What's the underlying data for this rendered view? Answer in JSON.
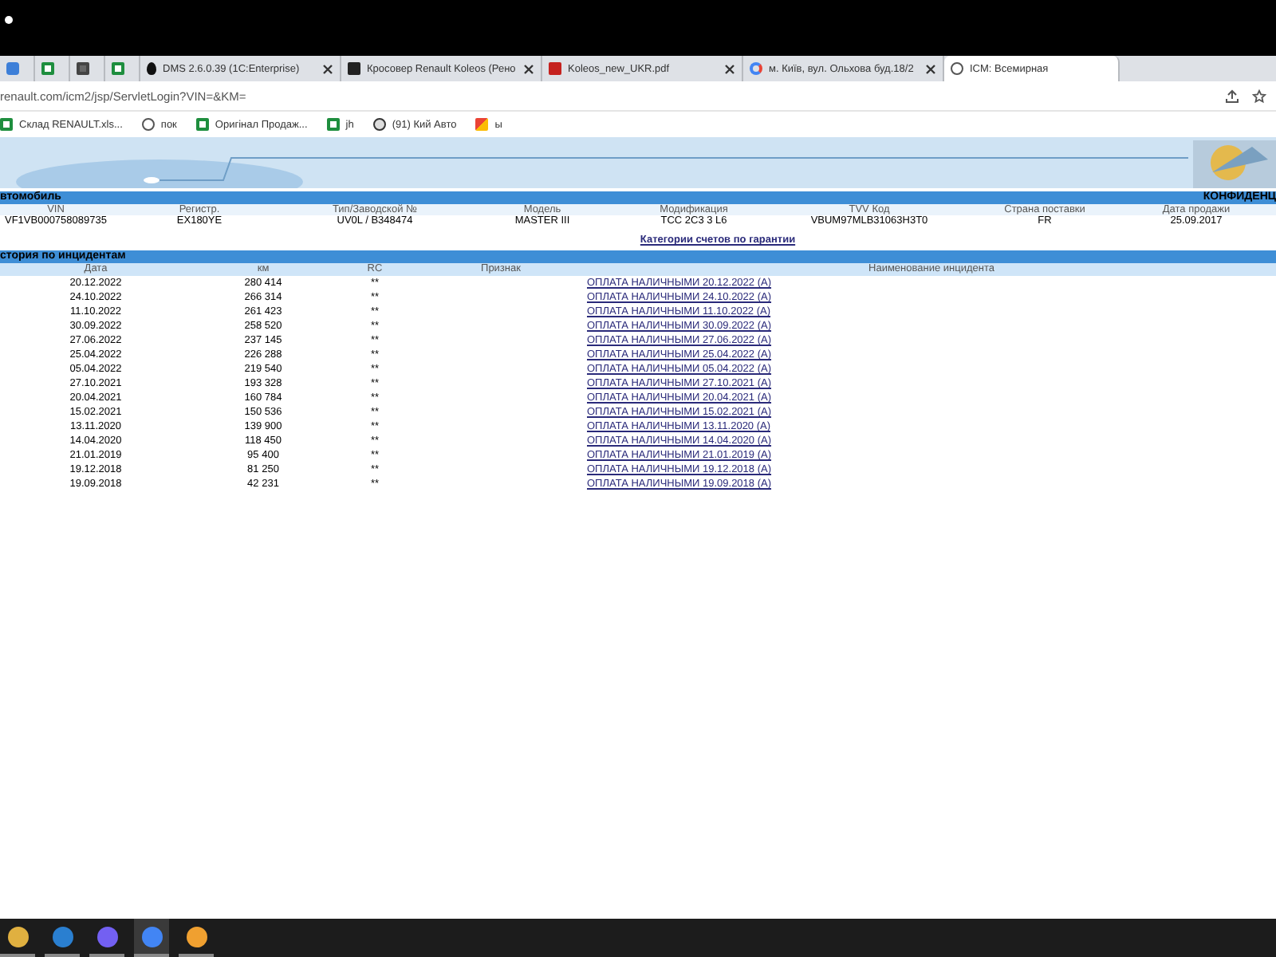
{
  "browser": {
    "tabs": [
      {
        "selected": false
      },
      {
        "selected": false
      },
      {
        "selected": false
      },
      {
        "selected": false
      },
      {
        "title": "DMS 2.6.0.39 (1C:Enterprise)",
        "selected": false
      },
      {
        "title": "Кросовер Renault Koleos (Рено",
        "selected": false
      },
      {
        "title": "Koleos_new_UKR.pdf",
        "selected": false
      },
      {
        "title": "м. Київ, вул. Ольхова буд.18/2",
        "selected": false
      },
      {
        "title": "ICM: Всемирная",
        "selected": true
      }
    ],
    "address": "renault.com/icm2/jsp/ServletLogin?VIN=&KM=",
    "bookmarks": [
      "Склад RENAULT.xls...",
      "пок",
      "Оригінал Продаж...",
      "jh",
      "(91) Кий Авто",
      "ы"
    ]
  },
  "vehicle": {
    "title": "втомобиль",
    "confidential": "КОНФИДЕНЦ",
    "columns": [
      "VIN",
      "Регистр.",
      "Тип/Заводской №",
      "Модель",
      "Модификация",
      "TVV Код",
      "Страна поставки",
      "Дата продажи"
    ],
    "values": [
      "VF1VB000758089735",
      "EX180YE",
      "UV0L / B348474",
      "MASTER III",
      "TCC 2C3 3 L6",
      "VBUM97MLB31063H3T0",
      "FR",
      "25.09.2017"
    ],
    "link": "Категории счетов по гарантии"
  },
  "history": {
    "title": "стория по инцидентам",
    "columns": [
      "Дата",
      "км",
      "RC",
      "Признак",
      "Наименование инцидента"
    ],
    "rows": [
      [
        "20.12.2022",
        "280 414",
        "**",
        "ОПЛАТА НАЛИЧНЫМИ 20.12.2022 (A)"
      ],
      [
        "24.10.2022",
        "266 314",
        "**",
        "ОПЛАТА НАЛИЧНЫМИ 24.10.2022 (A)"
      ],
      [
        "11.10.2022",
        "261 423",
        "**",
        "ОПЛАТА НАЛИЧНЫМИ 11.10.2022 (A)"
      ],
      [
        "30.09.2022",
        "258 520",
        "**",
        "ОПЛАТА НАЛИЧНЫМИ 30.09.2022 (A)"
      ],
      [
        "27.06.2022",
        "237 145",
        "**",
        "ОПЛАТА НАЛИЧНЫМИ 27.06.2022 (A)"
      ],
      [
        "25.04.2022",
        "226 288",
        "**",
        "ОПЛАТА НАЛИЧНЫМИ 25.04.2022 (A)"
      ],
      [
        "05.04.2022",
        "219 540",
        "**",
        "ОПЛАТА НАЛИЧНЫМИ 05.04.2022 (A)"
      ],
      [
        "27.10.2021",
        "193 328",
        "**",
        "ОПЛАТА НАЛИЧНЫМИ 27.10.2021 (A)"
      ],
      [
        "20.04.2021",
        "160 784",
        "**",
        "ОПЛАТА НАЛИЧНЫМИ 20.04.2021 (A)"
      ],
      [
        "15.02.2021",
        "150 536",
        "**",
        "ОПЛАТА НАЛИЧНЫМИ 15.02.2021 (A)"
      ],
      [
        "13.11.2020",
        "139 900",
        "**",
        "ОПЛАТА НАЛИЧНЫМИ 13.11.2020 (A)"
      ],
      [
        "14.04.2020",
        "118 450",
        "**",
        "ОПЛАТА НАЛИЧНЫМИ 14.04.2020 (A)"
      ],
      [
        "21.01.2019",
        "95 400",
        "**",
        "ОПЛАТА НАЛИЧНЫМИ 21.01.2019 (A)"
      ],
      [
        "19.12.2018",
        "81 250",
        "**",
        "ОПЛАТА НАЛИЧНЫМИ 19.12.2018 (A)"
      ],
      [
        "19.09.2018",
        "42 231",
        "**",
        "ОПЛАТА НАЛИЧНЫМИ 19.09.2018 (A)"
      ]
    ]
  },
  "taskbar": {
    "apps": [
      {
        "selected": false
      },
      {
        "selected": false
      },
      {
        "selected": false
      },
      {
        "selected": true
      },
      {
        "selected": false
      }
    ]
  }
}
